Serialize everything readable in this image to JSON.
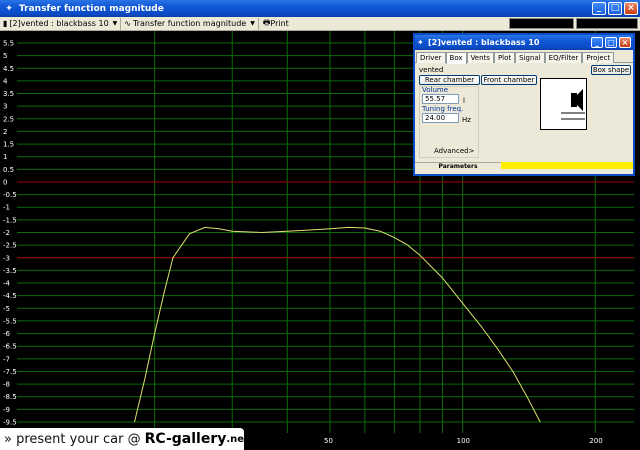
{
  "window": {
    "title": "Transfer function magnitude"
  },
  "toolbar": {
    "project_combo": "[2]vented : blackbass 10",
    "view_combo": "Transfer function magnitude",
    "print_label": "Print"
  },
  "dialog": {
    "title": "[2]vented :  blackbass 10",
    "tabs": [
      "Driver",
      "Box",
      "Vents",
      "Plot",
      "Signal",
      "EQ/Filter",
      "Project"
    ],
    "active_tab": "Box",
    "box_type": "vented",
    "box_shape_button": "Box shape",
    "rear_chamber_button": "Rear chamber",
    "front_chamber_button": "Front chamber",
    "volume": {
      "label": "Volume",
      "value": "55.57",
      "unit": "l"
    },
    "tuning": {
      "label": "Tuning freq.",
      "value": "24.00",
      "unit": "Hz"
    },
    "advanced_label": "Advanced>",
    "status_label": "Parameters",
    "colors": {
      "status_fill": "#ffee00"
    }
  },
  "chart_data": {
    "type": "line",
    "ylim": [
      -9.5,
      5.5
    ],
    "y_ticks": [
      "5.5",
      "5",
      "4.5",
      "4",
      "3.5",
      "3",
      "2.5",
      "2",
      "1.5",
      "1",
      "0.5",
      "0",
      "-0.5",
      "-1",
      "-1.5",
      "-2",
      "-2.5",
      "-3",
      "-3.5",
      "-4",
      "-4.5",
      "-5",
      "-5.5",
      "-6",
      "-6.5",
      "-7",
      "-7.5",
      "-8",
      "-8.5",
      "-9",
      "-9.5"
    ],
    "x_scale": "log",
    "xlim": [
      10,
      250
    ],
    "x_tick_labels": [
      {
        "value": 50,
        "label": "50"
      },
      {
        "value": 100,
        "label": "100"
      },
      {
        "value": 200,
        "label": "200"
      }
    ],
    "x_grid": [
      20,
      30,
      40,
      50,
      60,
      70,
      80,
      90,
      100,
      200
    ],
    "reference_lines": [
      {
        "y": 0,
        "color": "#a00000"
      },
      {
        "y": -3,
        "color": "#a00000"
      }
    ],
    "grid": true,
    "colors": {
      "background": "#000000",
      "grid": "#0a6a0a",
      "curve": "#e0e070"
    },
    "series": [
      {
        "x": [
          18,
          19,
          20,
          21,
          22,
          24,
          26,
          28,
          30,
          35,
          40,
          45,
          50,
          55,
          60,
          65,
          70,
          75,
          80,
          90,
          100,
          110,
          120,
          130,
          140,
          150
        ],
        "y": [
          -9.5,
          -7.8,
          -6.0,
          -4.4,
          -3.0,
          -2.05,
          -1.8,
          -1.85,
          -1.95,
          -2.0,
          -1.95,
          -1.9,
          -1.85,
          -1.8,
          -1.82,
          -1.95,
          -2.2,
          -2.5,
          -2.9,
          -3.8,
          -4.8,
          -5.7,
          -6.6,
          -7.5,
          -8.5,
          -9.5
        ]
      }
    ]
  },
  "watermark": {
    "prefix": "» present your car @",
    "brand": "RC-gallery",
    "tld": ".net"
  }
}
